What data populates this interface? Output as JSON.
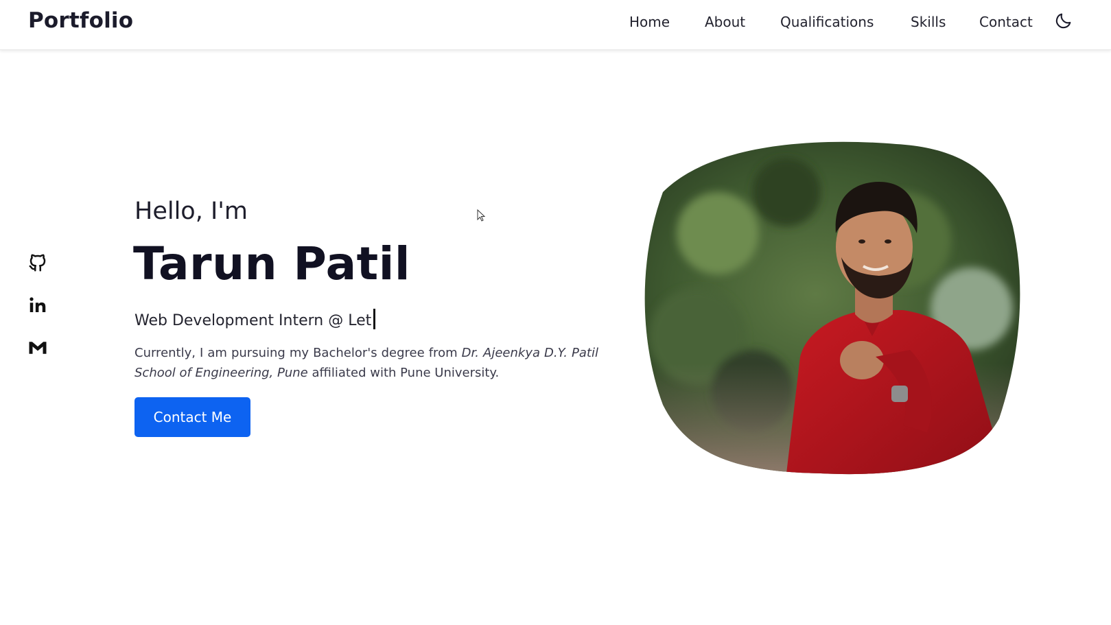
{
  "header": {
    "logo": "Portfolio",
    "nav": [
      "Home",
      "About",
      "Qualifications",
      "Skills",
      "Contact"
    ],
    "theme_icon": "moon-icon"
  },
  "social": [
    {
      "icon": "github-icon"
    },
    {
      "icon": "linkedin-icon"
    },
    {
      "icon": "gmail-icon"
    }
  ],
  "hero": {
    "greeting": "Hello, I'm",
    "name": "Tarun Patil",
    "role": "Web Development Intern @ Let",
    "desc_pre": "Currently, I am pursuing my Bachelor's degree from ",
    "desc_college": "Dr. Ajeenkya D.Y. Patil School of Engineering, Pune",
    "desc_post": " affiliated with Pune University.",
    "cta": "Contact Me"
  },
  "colors": {
    "accent": "#0d63f1",
    "text": "#14142b",
    "shirt": "#b3121c"
  }
}
